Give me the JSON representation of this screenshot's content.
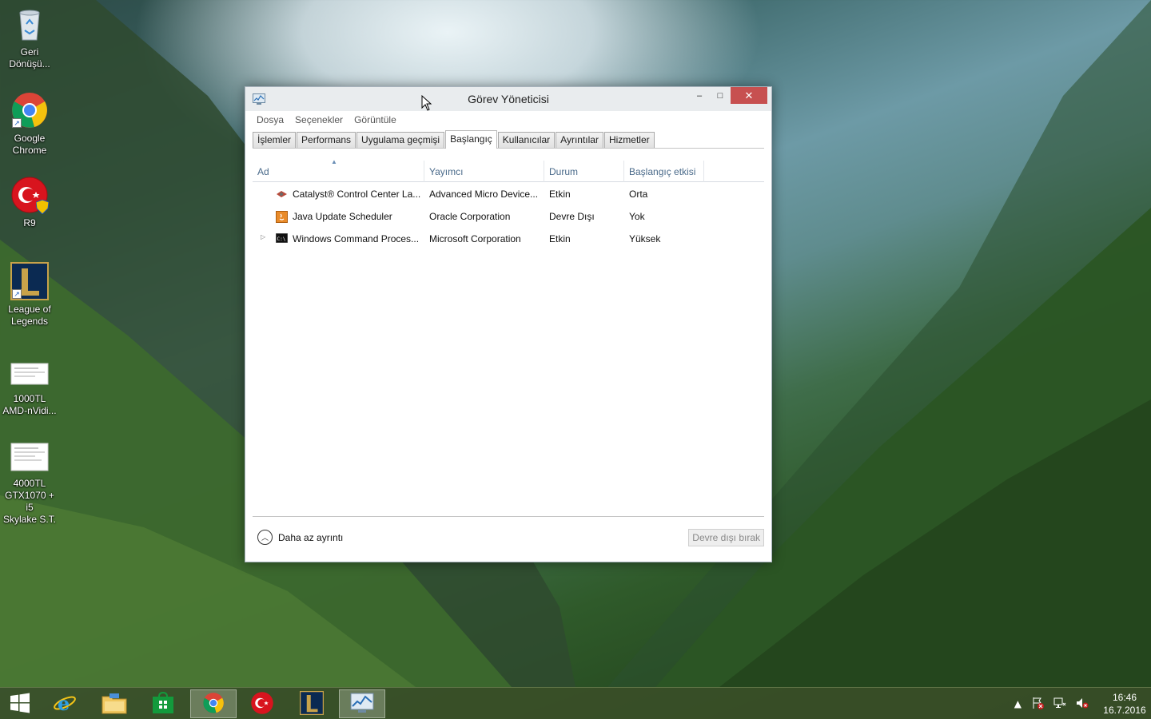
{
  "desktop": {
    "icons": [
      {
        "label": "Geri\nDönüşü..."
      },
      {
        "label": "Google\nChrome"
      },
      {
        "label": "R9"
      },
      {
        "label": "League of\nLegends"
      },
      {
        "label": "1000TL\nAMD-nVidi..."
      },
      {
        "label": "4000TL\nGTX1070 + i5\nSkylake S.T."
      }
    ]
  },
  "window": {
    "title": "Görev Yöneticisi",
    "minimize": "–",
    "maximize": "□",
    "close": "✕"
  },
  "menu": [
    "Dosya",
    "Seçenekler",
    "Görüntüle"
  ],
  "tabs": [
    "İşlemler",
    "Performans",
    "Uygulama geçmişi",
    "Başlangıç",
    "Kullanıcılar",
    "Ayrıntılar",
    "Hizmetler"
  ],
  "active_tab": "Başlangıç",
  "columns": [
    "Ad",
    "Yayımcı",
    "Durum",
    "Başlangıç etkisi"
  ],
  "rows": [
    {
      "name": "Catalyst® Control Center La...",
      "publisher": "Advanced Micro Device...",
      "status": "Etkin",
      "impact": "Orta",
      "icon": "amd-icon"
    },
    {
      "name": "Java Update Scheduler",
      "publisher": "Oracle Corporation",
      "status": "Devre Dışı",
      "impact": "Yok",
      "icon": "java-icon"
    },
    {
      "name": "Windows Command Proces...",
      "publisher": "Microsoft Corporation",
      "status": "Etkin",
      "impact": "Yüksek",
      "icon": "cmd-icon"
    }
  ],
  "footer": {
    "less_detail": "Daha az ayrıntı",
    "disable_button": "Devre dışı bırak"
  },
  "taskbar": {
    "apps": [
      "start-icon",
      "internet-explorer-icon",
      "file-explorer-icon",
      "store-icon",
      "chrome-icon",
      "r9-icon",
      "league-icon",
      "task-manager-icon"
    ],
    "time": "16:46",
    "date": "16.7.2016"
  }
}
